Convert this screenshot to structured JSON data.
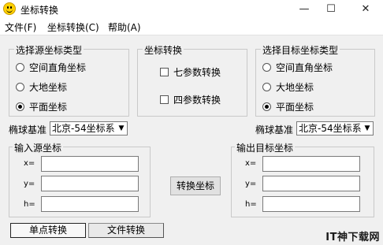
{
  "window": {
    "title": "坐标转换",
    "minimize": "—",
    "maximize": "☐",
    "close": "✕"
  },
  "menu": [
    "文件(F)",
    "坐标转换(C)",
    "帮助(A)"
  ],
  "source_group": {
    "title": "选择源坐标类型",
    "options": [
      {
        "label": "空间直角坐标",
        "selected": false
      },
      {
        "label": "大地坐标",
        "selected": false
      },
      {
        "label": "平面坐标",
        "selected": true
      }
    ]
  },
  "transform_group": {
    "title": "坐标转换",
    "options": [
      {
        "label": "七参数转换",
        "checked": false
      },
      {
        "label": "四参数转换",
        "checked": false
      }
    ]
  },
  "target_group": {
    "title": "选择目标坐标类型",
    "options": [
      {
        "label": "空间直角坐标",
        "selected": false
      },
      {
        "label": "大地坐标",
        "selected": false
      },
      {
        "label": "平面坐标",
        "selected": true
      }
    ]
  },
  "ellipsoid_source": {
    "label": "椭球基准",
    "value": "北京-54坐标系"
  },
  "ellipsoid_target": {
    "label": "椭球基准",
    "value": "北京-54坐标系"
  },
  "input_group": {
    "title": "输入源坐标",
    "fields": [
      {
        "label": "x=",
        "value": ""
      },
      {
        "label": "y=",
        "value": ""
      },
      {
        "label": "h=",
        "value": ""
      }
    ]
  },
  "output_group": {
    "title": "输出目标坐标",
    "fields": [
      {
        "label": "x=",
        "value": ""
      },
      {
        "label": "y=",
        "value": ""
      },
      {
        "label": "h=",
        "value": ""
      }
    ]
  },
  "convert_button": "转换坐标",
  "tabs": [
    {
      "label": "单点转换",
      "selected": true
    },
    {
      "label": "文件转换",
      "selected": false
    }
  ],
  "watermark": "IT神下载网"
}
